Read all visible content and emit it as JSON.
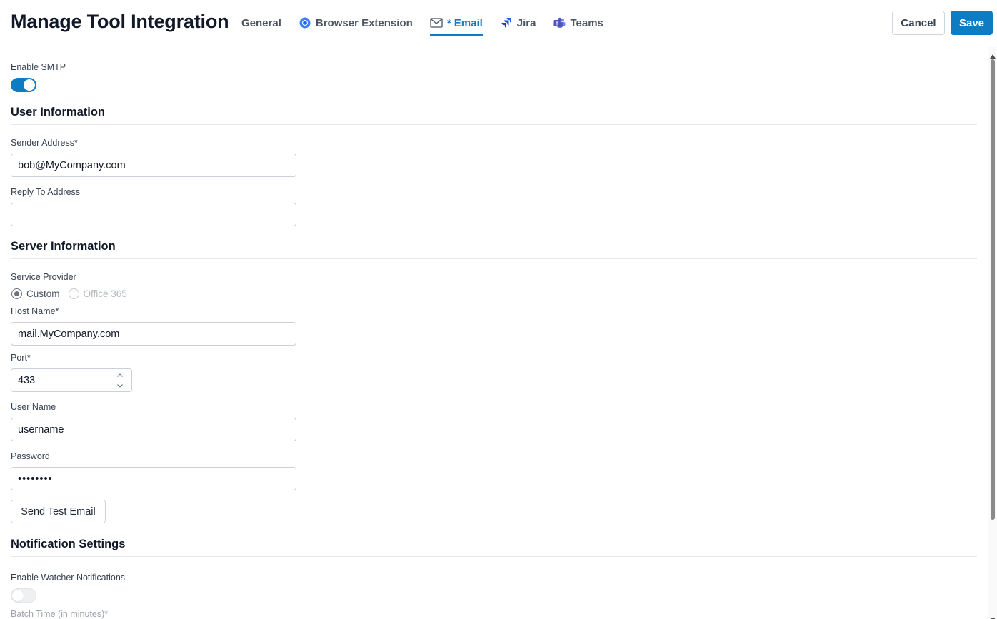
{
  "header": {
    "title": "Manage Tool Integration",
    "tabs": [
      {
        "label": "General",
        "icon": "none",
        "active": false
      },
      {
        "label": "Browser Extension",
        "icon": "chrome-icon",
        "active": false
      },
      {
        "label": "* Email",
        "icon": "mail-icon",
        "active": true
      },
      {
        "label": "Jira",
        "icon": "jira-icon",
        "active": false
      },
      {
        "label": "Teams",
        "icon": "teams-icon",
        "active": false
      }
    ],
    "cancel_label": "Cancel",
    "save_label": "Save"
  },
  "smtp": {
    "label": "Enable SMTP",
    "enabled": true
  },
  "user_info": {
    "title": "User Information",
    "sender_label": "Sender Address*",
    "sender_value": "bob@MyCompany.com",
    "reply_label": "Reply To Address",
    "reply_value": ""
  },
  "server_info": {
    "title": "Server Information",
    "provider_label": "Service Provider",
    "providers": [
      {
        "label": "Custom",
        "checked": true,
        "disabled": false
      },
      {
        "label": "Office 365",
        "checked": false,
        "disabled": true
      }
    ],
    "host_label": "Host Name*",
    "host_value": "mail.MyCompany.com",
    "port_label": "Port*",
    "port_value": "433",
    "username_label": "User Name",
    "username_value": "username",
    "password_label": "Password",
    "password_value": "••••••••",
    "test_button_label": "Send Test Email"
  },
  "notifications": {
    "title": "Notification Settings",
    "watcher_label": "Enable Watcher Notifications",
    "watcher_enabled": false,
    "batch_label": "Batch Time (in minutes)*"
  },
  "colors": {
    "accent": "#0e7cc3",
    "border": "#cbd0d6",
    "text": "#111827"
  }
}
